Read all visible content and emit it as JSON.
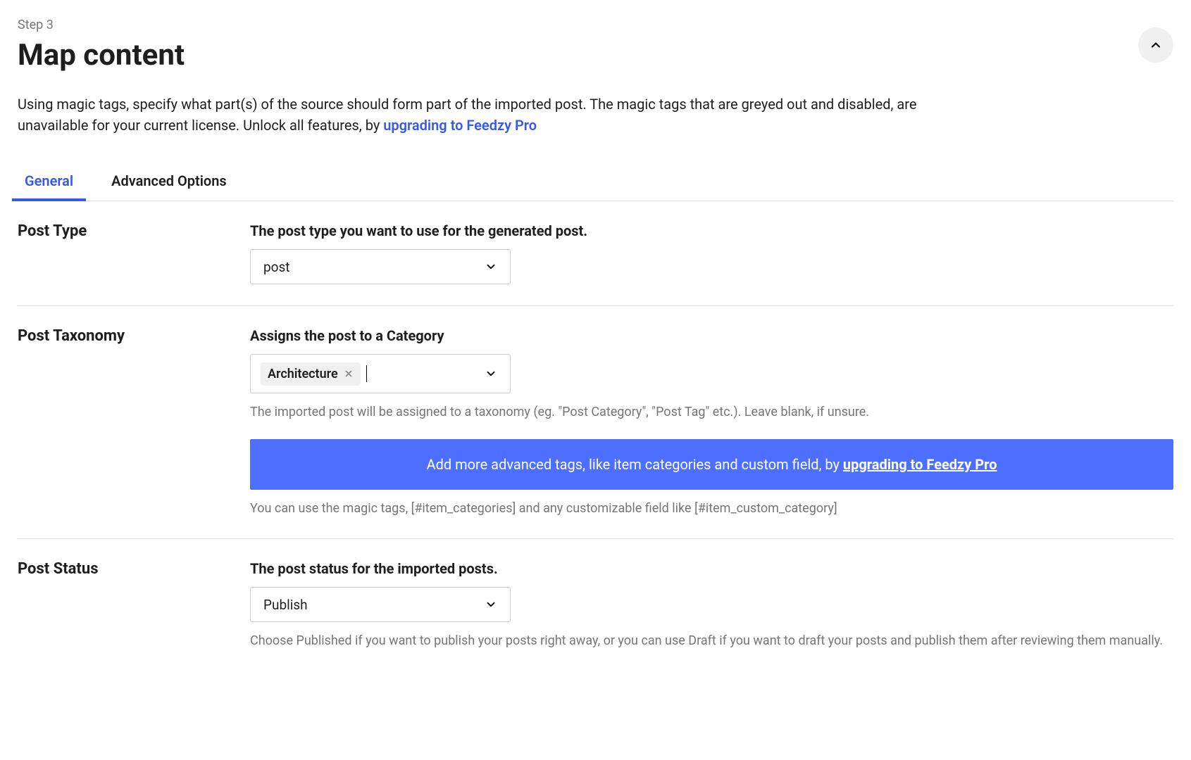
{
  "step": "Step 3",
  "title": "Map content",
  "description_part1": "Using magic tags, specify what part(s) of the source should form part of the imported post. The magic tags that are greyed out and disabled, are unavailable for your current license. Unlock all features, by ",
  "description_link": "upgrading to Feedzy Pro",
  "tabs": {
    "general": "General",
    "advanced": "Advanced Options"
  },
  "post_type": {
    "label": "Post Type",
    "title": "The post type you want to use for the generated post.",
    "value": "post"
  },
  "post_taxonomy": {
    "label": "Post Taxonomy",
    "title": "Assigns the post to a Category",
    "tag": "Architecture",
    "hint": "The imported post will be assigned to a taxonomy (eg. \"Post Category\", \"Post Tag\" etc.). Leave blank, if unsure.",
    "banner_text": "Add more advanced tags, like item categories and custom field, by ",
    "banner_link": "upgrading to Feedzy Pro",
    "magic_hint": "You can use the magic tags, [#item_categories] and any customizable field like [#item_custom_category]"
  },
  "post_status": {
    "label": "Post Status",
    "title": "The post status for the imported posts.",
    "value": "Publish",
    "hint": "Choose Published if you want to publish your posts right away, or you can use Draft if you want to draft your posts and publish them after reviewing them manually."
  }
}
